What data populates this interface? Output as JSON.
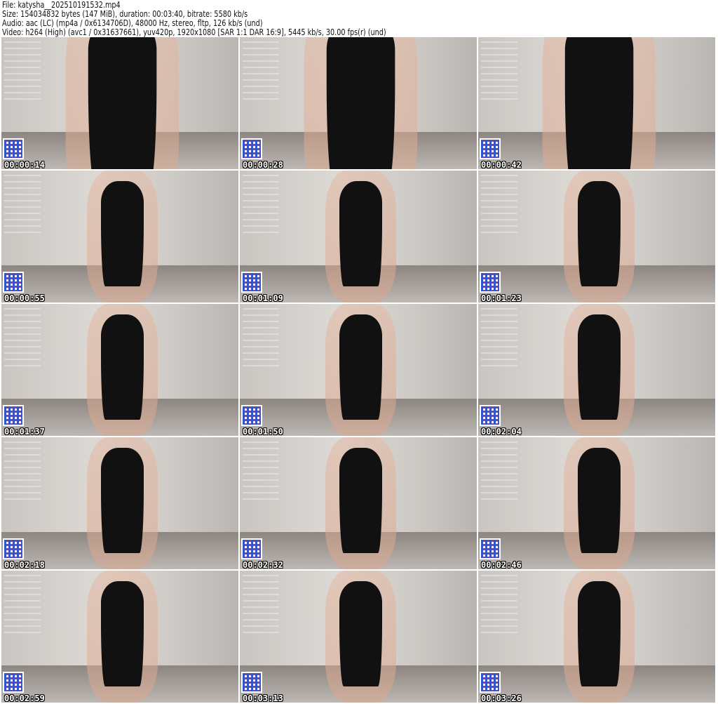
{
  "header": {
    "file": "File: katysha__202510191532.mp4",
    "size": "Size: 154034832 bytes (147 MiB), duration: 00:03:40, bitrate: 5580 kb/s",
    "audio": "Audio: aac (LC) (mp4a / 0x6134706D), 48000 Hz, stereo, fltp, 126 kb/s (und)",
    "video": "Video: h264 (High) (avc1 / 0x31637661), yuv420p, 1920x1080 [SAR 1:1 DAR 16:9], 5445 kb/s, 30.00 fps(r) (und)"
  },
  "thumbnails": [
    {
      "timestamp": "00:00:14"
    },
    {
      "timestamp": "00:00:28"
    },
    {
      "timestamp": "00:00:42"
    },
    {
      "timestamp": "00:00:55"
    },
    {
      "timestamp": "00:01:09"
    },
    {
      "timestamp": "00:01:23"
    },
    {
      "timestamp": "00:01:37"
    },
    {
      "timestamp": "00:01:50"
    },
    {
      "timestamp": "00:02:04"
    },
    {
      "timestamp": "00:02:18"
    },
    {
      "timestamp": "00:02:32"
    },
    {
      "timestamp": "00:02:46"
    },
    {
      "timestamp": "00:02:59"
    },
    {
      "timestamp": "00:03:13"
    },
    {
      "timestamp": "00:03:26"
    }
  ]
}
